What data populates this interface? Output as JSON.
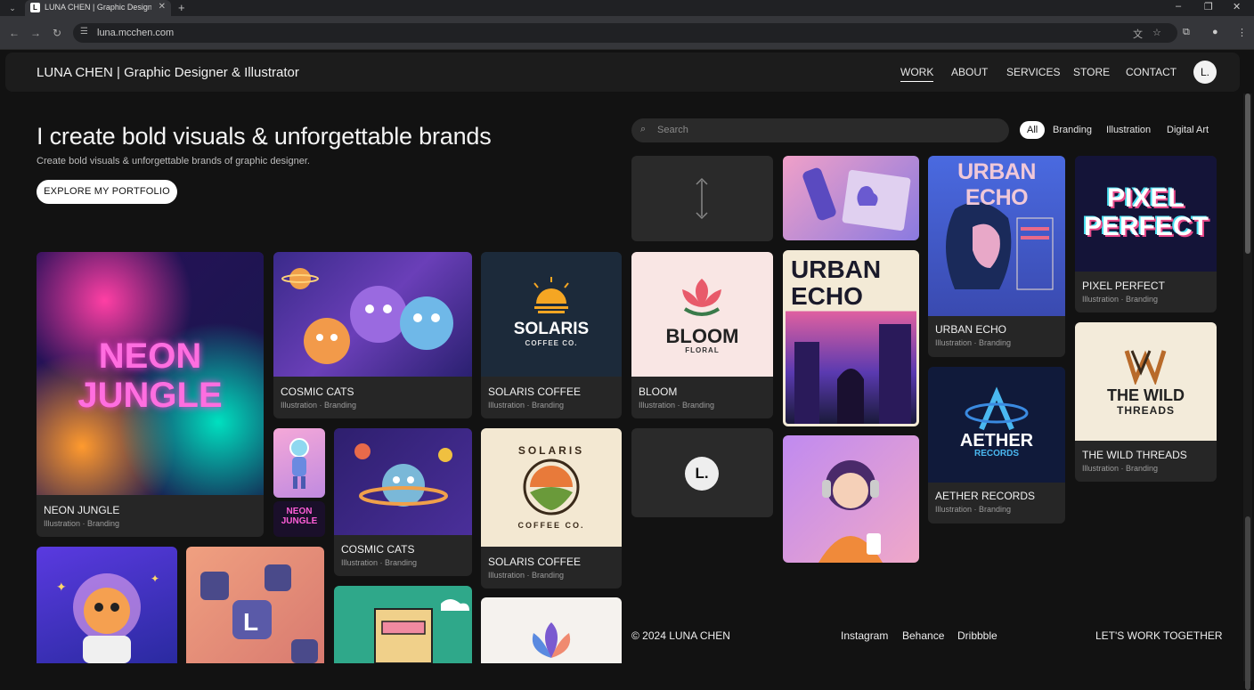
{
  "browser": {
    "tab_title": "LUNA CHEN | Graphic Designer",
    "tab_favicon": "L",
    "url": "luna.mcchen.com"
  },
  "site": {
    "brand": "LUNA CHEN | Graphic Designer & Illustrator",
    "nav": [
      "WORK",
      "ABOUT",
      "SERVICES",
      "STORE",
      "CONTACT"
    ],
    "avatar": "L."
  },
  "hero": {
    "title": "I create bold visuals & unforgettable brands",
    "subtitle": "Create bold visuals & unforgettable brands of graphic designer.",
    "cta": "EXPLORE MY PORTFOLIO"
  },
  "search": {
    "placeholder": "Search"
  },
  "filters": [
    "All",
    "Branding",
    "Illustration",
    "Digital Art"
  ],
  "cards": {
    "neon_jungle": {
      "title": "NEON JUNGLE",
      "tags": "Illustration · Branding",
      "art": "NEON JUNGLE"
    },
    "cosmic_cats_1": {
      "title": "COSMIC CATS",
      "tags": "Illustration · Branding"
    },
    "solaris_1": {
      "title": "SOLARIS COFFEE",
      "tags": "Illustration · Branding",
      "art_main": "SOLARIS",
      "art_sub": "COFFEE CO."
    },
    "bloom": {
      "title": "BLOOM",
      "tags": "Illustration · Branding",
      "art_main": "BLOOM",
      "art_sub": "FLORAL"
    },
    "cosmic_cats_2": {
      "title": "COSMIC CATS",
      "tags": "Illustration · Branding"
    },
    "solaris_2": {
      "title": "SOLARIS COFFEE",
      "tags": "Illustration · Branding",
      "art_main": "SOLARIS",
      "art_sub": "COFFEE CO."
    },
    "urban_echo_poster": {
      "art": "URBAN ECHO"
    },
    "urban_echo": {
      "title": "URBAN ECHO",
      "tags": "Illustration · Branding",
      "art": "URBAN ECHO"
    },
    "aether": {
      "title": "AETHER RECORDS",
      "tags": "Illustration · Branding",
      "art_main": "AETHER",
      "art_sub": "RECORDS"
    },
    "pixel": {
      "title": "PIXEL PERFECT",
      "tags": "Illustration · Branding",
      "art": "PIXEL PERFECT"
    },
    "wild": {
      "title": "THE WILD THREADS",
      "tags": "Illustration · Branding",
      "art_main": "THE WILD",
      "art_sub": "THREADS"
    },
    "small_neon": {
      "art": "NEON JUNGLE"
    },
    "logo_card": {
      "art": "L."
    }
  },
  "footer": {
    "copyright": "© 2024 LUNA CHEN",
    "links": [
      "Instagram",
      "Behance",
      "Dribbble"
    ],
    "cta": "LET'S WORK TOGETHER"
  }
}
